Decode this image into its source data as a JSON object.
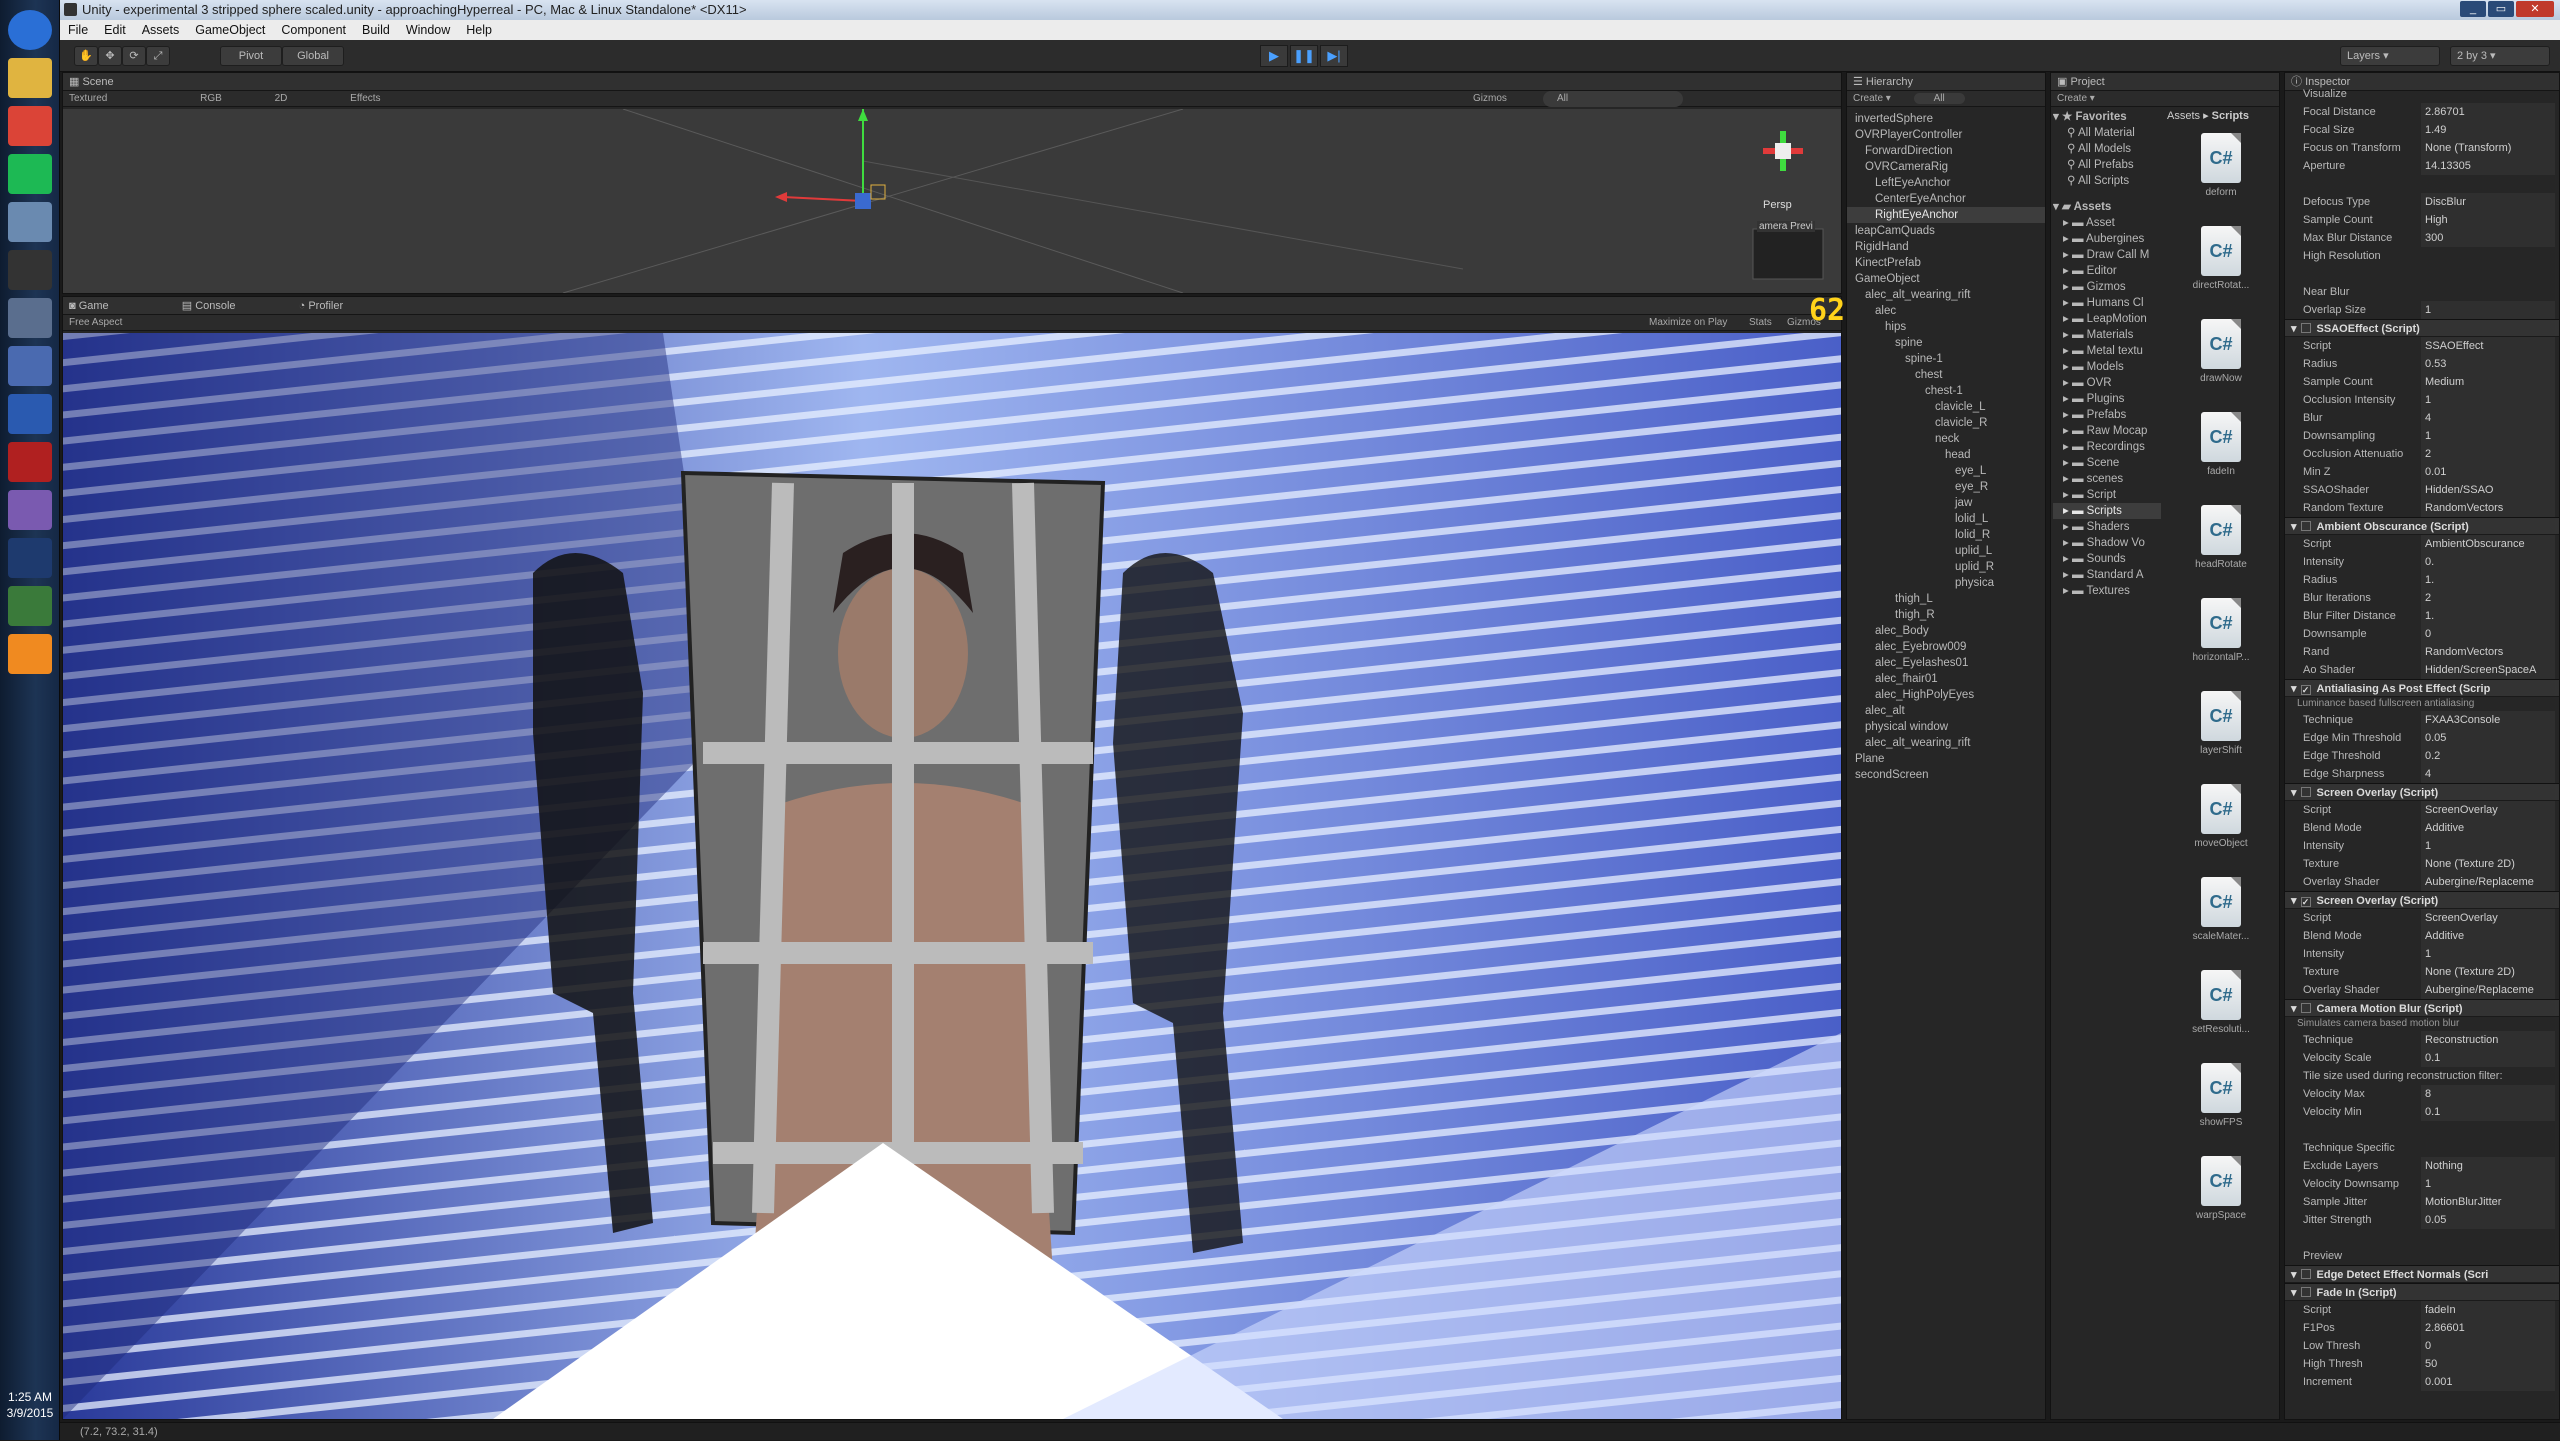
{
  "window": {
    "title": "Unity - experimental 3 stripped sphere scaled.unity - approachingHyperreal - PC, Mac & Linux Standalone* <DX11>"
  },
  "menu": [
    "File",
    "Edit",
    "Assets",
    "GameObject",
    "Component",
    "Build",
    "Window",
    "Help"
  ],
  "toolbar": {
    "pivot": "Pivot",
    "global": "Global",
    "layers": "Layers",
    "layout": "2 by 3"
  },
  "taskbar": {
    "time": "1:25 AM",
    "date": "3/9/2015",
    "icons": [
      "start-orb-icon",
      "folder-icon",
      "chrome-icon",
      "spotify-icon",
      "network-icon",
      "unity-icon",
      "calculator-icon",
      "remote-desktop-icon",
      "vnc-icon",
      "filezilla-icon",
      "app-icon",
      "photoshop-icon",
      "downloader-icon",
      "vlc-icon"
    ]
  },
  "scene": {
    "tab": "Scene",
    "shading": "Textured",
    "rgb": "RGB",
    "mode2d": "2D",
    "effects": "Effects",
    "gizmos": "Gizmos",
    "search": "All",
    "persp": "Persp",
    "preview_label": "amera Previ"
  },
  "game": {
    "tabs": [
      "Game",
      "Console",
      "Profiler"
    ],
    "aspect": "Free Aspect",
    "maximize": "Maximize on Play",
    "stats": "Stats",
    "gizmos": "Gizmos",
    "fps": "62"
  },
  "hierarchy": {
    "tab": "Hierarchy",
    "create": "Create",
    "search": "All",
    "items": [
      {
        "label": "invertedSphere",
        "indent": 0
      },
      {
        "label": "OVRPlayerController",
        "indent": 0
      },
      {
        "label": "ForwardDirection",
        "indent": 1
      },
      {
        "label": "OVRCameraRig",
        "indent": 1
      },
      {
        "label": "LeftEyeAnchor",
        "indent": 2
      },
      {
        "label": "CenterEyeAnchor",
        "indent": 2
      },
      {
        "label": "RightEyeAnchor",
        "indent": 2,
        "selected": true
      },
      {
        "label": "leapCamQuads",
        "indent": 0
      },
      {
        "label": "RigidHand",
        "indent": 0
      },
      {
        "label": "KinectPrefab",
        "indent": 0
      },
      {
        "label": "GameObject",
        "indent": 0
      },
      {
        "label": "alec_alt_wearing_rift",
        "indent": 1
      },
      {
        "label": "alec",
        "indent": 2
      },
      {
        "label": "hips",
        "indent": 3
      },
      {
        "label": "spine",
        "indent": 4
      },
      {
        "label": "spine-1",
        "indent": 5
      },
      {
        "label": "chest",
        "indent": 6
      },
      {
        "label": "chest-1",
        "indent": 7
      },
      {
        "label": "clavicle_L",
        "indent": 8
      },
      {
        "label": "clavicle_R",
        "indent": 8
      },
      {
        "label": "neck",
        "indent": 8
      },
      {
        "label": "head",
        "indent": 9
      },
      {
        "label": "eye_L",
        "indent": 10
      },
      {
        "label": "eye_R",
        "indent": 10
      },
      {
        "label": "jaw",
        "indent": 10
      },
      {
        "label": "lolid_L",
        "indent": 10
      },
      {
        "label": "lolid_R",
        "indent": 10
      },
      {
        "label": "uplid_L",
        "indent": 10
      },
      {
        "label": "uplid_R",
        "indent": 10
      },
      {
        "label": "physica",
        "indent": 10
      },
      {
        "label": "",
        "indent": 0
      },
      {
        "label": "thigh_L",
        "indent": 4
      },
      {
        "label": "thigh_R",
        "indent": 4
      },
      {
        "label": "alec_Body",
        "indent": 2
      },
      {
        "label": "alec_Eyebrow009",
        "indent": 2
      },
      {
        "label": "alec_Eyelashes01",
        "indent": 2
      },
      {
        "label": "alec_fhair01",
        "indent": 2
      },
      {
        "label": "alec_HighPolyEyes",
        "indent": 2
      },
      {
        "label": "alec_alt",
        "indent": 1
      },
      {
        "label": "physical window",
        "indent": 1
      },
      {
        "label": "alec_alt_wearing_rift",
        "indent": 1
      },
      {
        "label": "Plane",
        "indent": 0
      },
      {
        "label": "secondScreen",
        "indent": 0
      }
    ]
  },
  "project": {
    "tab": "Project",
    "create": "Create",
    "breadcrumb": [
      "Assets",
      "Scripts"
    ],
    "favorites_title": "Favorites",
    "favorites": [
      "All Material",
      "All Models",
      "All Prefabs",
      "All Scripts"
    ],
    "assets_title": "Assets",
    "folders": [
      "Asset",
      "Aubergines",
      "Draw Call M",
      "Editor",
      "Gizmos",
      "Humans Cl",
      "LeapMotion",
      "Materials",
      "Metal textu",
      "Models",
      "OVR",
      "Plugins",
      "Prefabs",
      "Raw Mocap",
      "Recordings",
      "Scene",
      "scenes",
      "Script",
      "Scripts",
      "Shaders",
      "Shadow Vo",
      "Sounds",
      "Standard A",
      "Textures"
    ],
    "selected_folder": "Scripts",
    "scripts": [
      "deform",
      "directRotat...",
      "drawNow",
      "fadeIn",
      "headRotate",
      "horizontalP...",
      "layerShift",
      "moveObject",
      "scaleMater...",
      "setResoluti...",
      "showFPS",
      "warpSpace"
    ]
  },
  "inspector": {
    "tab": "Inspector",
    "top": [
      {
        "k": "Visualize",
        "v": ""
      },
      {
        "k": "Focal Distance",
        "v": "2.86701"
      },
      {
        "k": "Focal Size",
        "v": "1.49"
      },
      {
        "k": "Focus on Transform",
        "v": "None (Transform)"
      },
      {
        "k": "Aperture",
        "v": "14.13305"
      },
      {
        "k": "",
        "v": ""
      },
      {
        "k": "Defocus Type",
        "v": "DiscBlur"
      },
      {
        "k": "Sample Count",
        "v": "High"
      },
      {
        "k": "Max Blur Distance",
        "v": "300"
      },
      {
        "k": "High Resolution",
        "v": ""
      },
      {
        "k": "",
        "v": ""
      },
      {
        "k": "Near Blur",
        "v": ""
      },
      {
        "k": "Overlap Size",
        "v": "1"
      }
    ],
    "components": [
      {
        "title": "SSAOEffect (Script)",
        "checked": false,
        "rows": [
          {
            "k": "Script",
            "v": "SSAOEffect"
          },
          {
            "k": "Radius",
            "v": "0.53"
          },
          {
            "k": "Sample Count",
            "v": "Medium"
          },
          {
            "k": "Occlusion Intensity",
            "v": "1"
          },
          {
            "k": "Blur",
            "v": "4"
          },
          {
            "k": "Downsampling",
            "v": "1"
          },
          {
            "k": "Occlusion Attenuatio",
            "v": "2"
          },
          {
            "k": "Min Z",
            "v": "0.01"
          },
          {
            "k": "SSAOShader",
            "v": "Hidden/SSAO"
          },
          {
            "k": "Random Texture",
            "v": "RandomVectors"
          }
        ]
      },
      {
        "title": "Ambient Obscurance (Script)",
        "checked": false,
        "rows": [
          {
            "k": "Script",
            "v": "AmbientObscurance"
          },
          {
            "k": "Intensity",
            "v": "0."
          },
          {
            "k": "Radius",
            "v": "1."
          },
          {
            "k": "Blur Iterations",
            "v": "2"
          },
          {
            "k": "Blur Filter Distance",
            "v": "1."
          },
          {
            "k": "Downsample",
            "v": "0"
          },
          {
            "k": "Rand",
            "v": "RandomVectors"
          },
          {
            "k": "Ao Shader",
            "v": "Hidden/ScreenSpaceA"
          }
        ]
      },
      {
        "title": "Antialiasing As Post Effect (Scrip",
        "checked": true,
        "note": "Luminance based fullscreen antialiasing",
        "rows": [
          {
            "k": "Technique",
            "v": "FXAA3Console"
          },
          {
            "k": "Edge Min Threshold",
            "v": "0.05"
          },
          {
            "k": "Edge Threshold",
            "v": "0.2"
          },
          {
            "k": "Edge Sharpness",
            "v": "4"
          }
        ]
      },
      {
        "title": "Screen Overlay (Script)",
        "checked": false,
        "rows": [
          {
            "k": "Script",
            "v": "ScreenOverlay"
          },
          {
            "k": "Blend Mode",
            "v": "Additive"
          },
          {
            "k": "Intensity",
            "v": "1"
          },
          {
            "k": "Texture",
            "v": "None (Texture 2D)"
          },
          {
            "k": "Overlay Shader",
            "v": "Aubergine/Replaceme"
          }
        ]
      },
      {
        "title": "Screen Overlay (Script)",
        "checked": true,
        "rows": [
          {
            "k": "Script",
            "v": "ScreenOverlay"
          },
          {
            "k": "Blend Mode",
            "v": "Additive"
          },
          {
            "k": "Intensity",
            "v": "1"
          },
          {
            "k": "Texture",
            "v": "None (Texture 2D)"
          },
          {
            "k": "Overlay Shader",
            "v": "Aubergine/Replaceme"
          }
        ]
      },
      {
        "title": "Camera Motion Blur (Script)",
        "checked": false,
        "note": "Simulates camera based motion blur",
        "rows": [
          {
            "k": "Technique",
            "v": "Reconstruction"
          },
          {
            "k": "Velocity Scale",
            "v": "0.1"
          },
          {
            "k": "Tile size used during reconstruction filter:",
            "v": ""
          },
          {
            "k": "Velocity Max",
            "v": "8"
          },
          {
            "k": "Velocity Min",
            "v": "0.1"
          },
          {
            "k": "",
            "v": ""
          },
          {
            "k": "Technique Specific",
            "v": ""
          },
          {
            "k": "Exclude Layers",
            "v": "Nothing"
          },
          {
            "k": "Velocity Downsamp",
            "v": "1"
          },
          {
            "k": "Sample Jitter",
            "v": "MotionBlurJitter"
          },
          {
            "k": "Jitter Strength",
            "v": "0.05"
          },
          {
            "k": "",
            "v": ""
          },
          {
            "k": "Preview",
            "v": ""
          }
        ]
      },
      {
        "title": "Edge Detect Effect Normals (Scri",
        "checked": false,
        "rows": []
      },
      {
        "title": "Fade In (Script)",
        "checked": false,
        "rows": [
          {
            "k": "Script",
            "v": "fadeIn"
          },
          {
            "k": "F1Pos",
            "v": "2.86601"
          },
          {
            "k": "Low Thresh",
            "v": "0"
          },
          {
            "k": "High Thresh",
            "v": "50"
          },
          {
            "k": "Increment",
            "v": "0.001"
          }
        ]
      }
    ]
  },
  "status": {
    "text": "(7.2, 73.2, 31.4)"
  }
}
